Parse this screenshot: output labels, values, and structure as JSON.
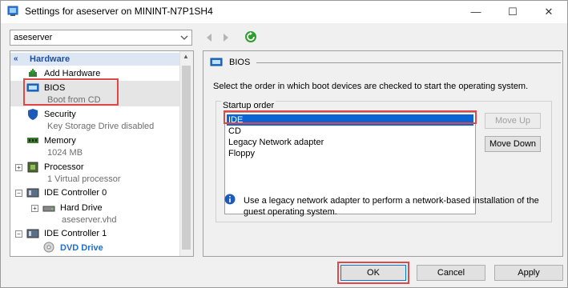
{
  "window": {
    "title": "Settings for aseserver on MININT-N7P1SH4",
    "minimize_glyph": "—",
    "maximize_glyph": "☐",
    "close_glyph": "✕"
  },
  "toolbar": {
    "server_selected": "aseserver",
    "back_icon": "back-arrow-icon",
    "forward_icon": "forward-arrow-icon",
    "refresh_icon": "refresh-icon"
  },
  "tree": {
    "header": "Hardware",
    "items": [
      {
        "label": "Add Hardware",
        "sub": "",
        "icon": "add-hardware-icon"
      },
      {
        "label": "BIOS",
        "sub": "Boot from CD",
        "icon": "bios-icon"
      },
      {
        "label": "Security",
        "sub": "Key Storage Drive disabled",
        "icon": "shield-icon"
      },
      {
        "label": "Memory",
        "sub": "1024 MB",
        "icon": "memory-icon"
      },
      {
        "label": "Processor",
        "sub": "1 Virtual processor",
        "icon": "processor-icon"
      },
      {
        "label": "IDE Controller 0",
        "sub": "",
        "icon": "ide-controller-icon"
      },
      {
        "label": "Hard Drive",
        "sub": "aseserver.vhd",
        "icon": "hard-drive-icon"
      },
      {
        "label": "IDE Controller 1",
        "sub": "",
        "icon": "ide-controller-icon"
      },
      {
        "label": "DVD Drive",
        "sub": "",
        "icon": "dvd-drive-icon"
      }
    ]
  },
  "bios": {
    "section_title": "BIOS",
    "instruction": "Select the order in which boot devices are checked to start the operating system.",
    "startup_order_label": "Startup order",
    "boot_devices": [
      "IDE",
      "CD",
      "Legacy Network adapter",
      "Floppy"
    ],
    "selected_device": "IDE",
    "move_up_label": "Move Up",
    "move_down_label": "Move Down",
    "info_text": "Use a legacy network adapter to perform a network-based installation of the guest operating system."
  },
  "footer": {
    "ok_label": "OK",
    "cancel_label": "Cancel",
    "apply_label": "Apply"
  },
  "colors": {
    "selection": "#0a64d2",
    "highlight_box": "#e04848",
    "tree_header_text": "#1e4e9c",
    "dvd_text": "#1e6fd0"
  }
}
